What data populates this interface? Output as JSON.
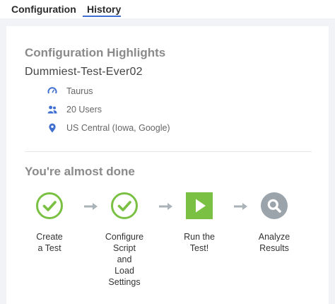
{
  "tabs": [
    {
      "label": "Configuration",
      "active": false
    },
    {
      "label": "History",
      "active": true
    }
  ],
  "highlights": {
    "heading": "Configuration Highlights",
    "test_name": "Dummiest-Test-Ever02",
    "items": [
      {
        "icon": "speedometer-icon",
        "text": "Taurus"
      },
      {
        "icon": "users-icon",
        "text": "20 Users"
      },
      {
        "icon": "location-pin-icon",
        "text": "US Central (Iowa, Google)"
      }
    ]
  },
  "progress": {
    "heading": "You're almost done",
    "steps": [
      {
        "label": "Create\na Test",
        "state": "done"
      },
      {
        "label": "Configure\nScript\nand\nLoad\nSettings",
        "state": "done"
      },
      {
        "label": "Run the\nTest!",
        "state": "current"
      },
      {
        "label": "Analyze\nResults",
        "state": "pending"
      }
    ]
  },
  "colors": {
    "accent": "#3f6fd1",
    "done": "#7ac143",
    "pending": "#9aa4aa",
    "arrow": "#a9b3b8",
    "heading": "#8a8a8a"
  }
}
